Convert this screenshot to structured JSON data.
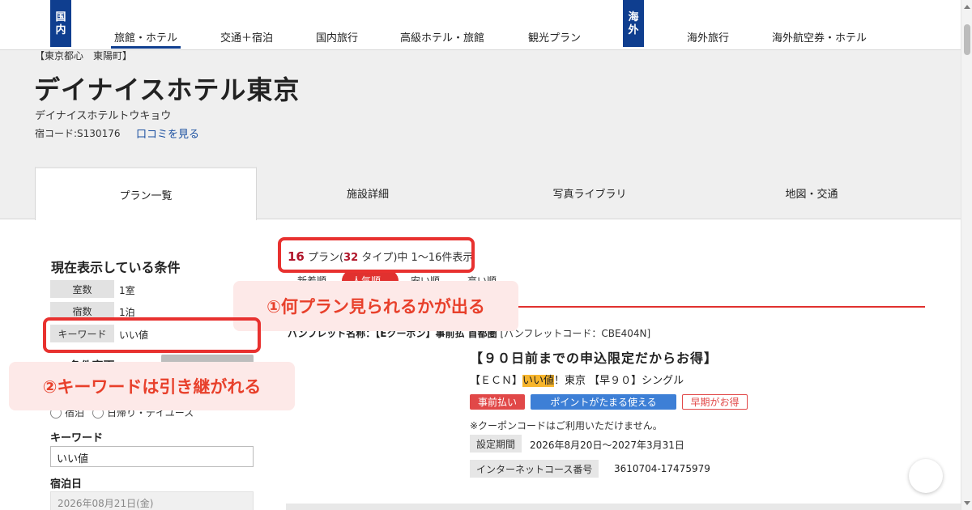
{
  "nav": {
    "domestic_badge": [
      "国",
      "内"
    ],
    "overseas_badge": [
      "海",
      "外"
    ],
    "items": [
      "旅館・ホテル",
      "交通＋宿泊",
      "国内旅行",
      "高級ホテル・旅館",
      "観光プラン",
      "海外旅行",
      "海外航空券・ホテル"
    ]
  },
  "hotel": {
    "location": "【東京都心　東陽町】",
    "name": "デイナイスホテル東京",
    "kana": "デイナイスホテルトウキョウ",
    "code": "宿コード:S130176",
    "review_link": "口コミを見る"
  },
  "tabs": [
    "プラン一覧",
    "施設詳細",
    "写真ライブラリ",
    "地図・交通"
  ],
  "sidebar": {
    "title": "現在表示している条件",
    "conditions": [
      {
        "label": "室数",
        "value": "1室"
      },
      {
        "label": "宿数",
        "value": "1泊"
      },
      {
        "label": "キーワード",
        "value": "いい値"
      }
    ],
    "partial_heading": "<<条件変更",
    "radios": [
      "宿泊",
      "日帰り・デイユース"
    ],
    "keyword_label": "キーワード",
    "keyword_value": "いい値",
    "date_label": "宿泊日",
    "date_value": "2026年08月21日(金)"
  },
  "results": {
    "count_plans": "16",
    "count_text_1": "プラン(",
    "count_types": "32",
    "count_text_2": "タイプ)中 1〜16件表示",
    "sort": [
      "新着順",
      "人気順",
      "安い順",
      "高い順"
    ]
  },
  "plan": {
    "pamphlet_name": "パンフレット名称：【Eクーポン】事前払 首都圏",
    "pamphlet_code": "[パンフレットコード：CBE404N]",
    "title": "【９０日前までの申込限定だからお得】",
    "sub_prefix": "【ＥＣＮ】",
    "sub_highlight": "いい値",
    "sub_suffix": "！東京 【早９０】シングル",
    "badges": [
      "事前払い",
      "ポイントがたまる使える",
      "早期がお得"
    ],
    "coupon_note": "※クーポンコードはご利用いただけません。",
    "period_label": "設定期間",
    "period_value": "2026年8月20日〜2027年3月31日",
    "course_label": "インターネットコース番号",
    "course_value": "3610704-17475979"
  },
  "callouts": {
    "first": "①何プラン見られるかが出る",
    "second": "②キーワードは引き継がれる"
  },
  "colors": {
    "brand_navy": "#0f3e8f",
    "accent_red": "#e1312f",
    "callout_bg": "#fde9e8",
    "link_blue": "#1a4fa0",
    "highlight": "#f7b52c"
  }
}
